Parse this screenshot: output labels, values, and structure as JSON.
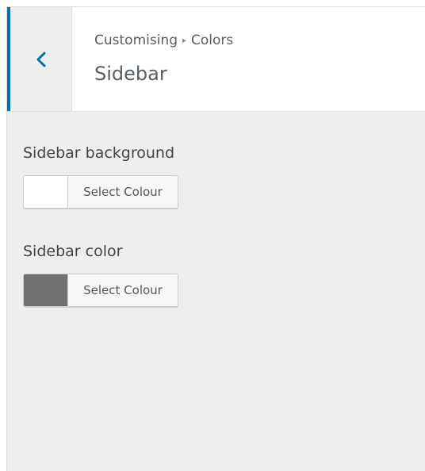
{
  "header": {
    "breadcrumb_root": "Customising",
    "breadcrumb_separator": "▸",
    "breadcrumb_current": "Colors",
    "title": "Sidebar",
    "back_icon": "chevron-left-icon"
  },
  "controls": [
    {
      "label": "Sidebar background",
      "button_label": "Select Colour",
      "swatch_color": "#ffffff"
    },
    {
      "label": "Sidebar color",
      "button_label": "Select Colour",
      "swatch_color": "#707070"
    }
  ],
  "colors": {
    "accent": "#0073aa",
    "panel_background": "#eeeeee",
    "header_background": "#ffffff",
    "text": "#555d66"
  }
}
